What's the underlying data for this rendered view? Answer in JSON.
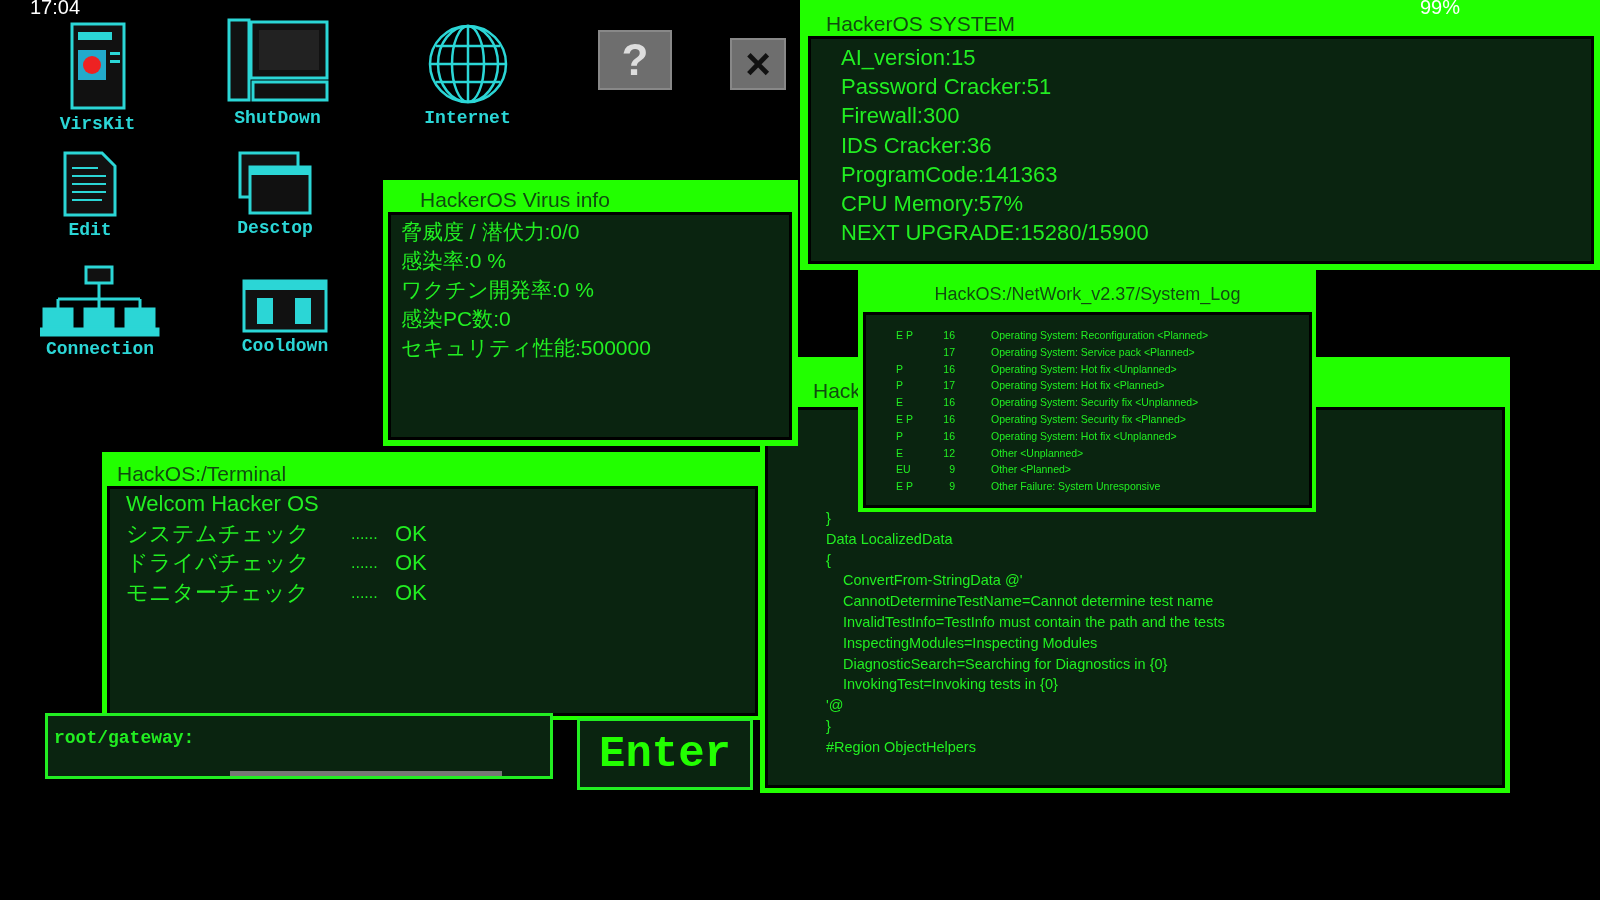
{
  "status_bar": {
    "time": "17:04",
    "battery": "99%"
  },
  "desktop_icons": [
    {
      "kind": "virus",
      "label": "VirsKit"
    },
    {
      "kind": "computer",
      "label": "ShutDown"
    },
    {
      "kind": "globe",
      "label": "Internet"
    },
    {
      "kind": "document",
      "label": "Edit"
    },
    {
      "kind": "windows",
      "label": "Desctop"
    },
    {
      "kind": "network",
      "label": "Connection"
    },
    {
      "kind": "panel",
      "label": "Cooldown"
    }
  ],
  "top_buttons": [
    {
      "kind": "help",
      "symbol": "?"
    },
    {
      "kind": "close",
      "symbol": "×"
    }
  ],
  "windows": [
    {
      "kind": "system",
      "title": "HackerOS SYSTEM",
      "lines": [
        "AI_version:15",
        "Password  Cracker:51",
        "Firewall:300",
        "IDS  Cracker:36",
        "ProgramCode:141363",
        "CPU  Memory:57%",
        "NEXT  UPGRADE:15280/15900"
      ]
    },
    {
      "kind": "virus",
      "title": "HackerOS Virus  info",
      "lines": [
        "脅威度 / 潜伏力:0/0",
        "感染率:0 %",
        "ワクチン開発率:0 %",
        "感染PC数:0",
        "セキュリティ性能:500000"
      ]
    },
    {
      "kind": "log",
      "title": "HackOS:/NetWork_v2.37/System_Log",
      "rows": [
        {
          "flags": "E P",
          "number": "16",
          "message": "Operating System: Reconfiguration <Planned>"
        },
        {
          "flags": "",
          "number": "17",
          "message": "Operating System: Service pack <Planned>"
        },
        {
          "flags": "P",
          "number": "16",
          "message": "Operating System: Hot fix <Unplanned>"
        },
        {
          "flags": "P",
          "number": "17",
          "message": "Operating System: Hot fix <Planned>"
        },
        {
          "flags": "E",
          "number": "16",
          "message": "Operating System: Security fix <Unplanned>"
        },
        {
          "flags": "E P",
          "number": "16",
          "message": "Operating System: Security fix <Planned>"
        },
        {
          "flags": "P",
          "number": "16",
          "message": "Operating System: Hot fix <Unplanned>"
        },
        {
          "flags": "E",
          "number": "12",
          "message": "Other <Unplanned>"
        },
        {
          "flags": "EU",
          "number": "9",
          "message": "Other <Planned>"
        },
        {
          "flags": "E P",
          "number": "9",
          "message": "Other Failure: System Unresponsive"
        }
      ]
    },
    {
      "kind": "code",
      "title": "Hack",
      "lines": [
        {
          "text": "}",
          "indent": false
        },
        {
          "text": "Data LocalizedData",
          "indent": false
        },
        {
          "text": "{",
          "indent": false
        },
        {
          "text": "ConvertFrom-StringData @'",
          "indent": true
        },
        {
          "text": "CannotDetermineTestName=Cannot determine test name",
          "indent": true
        },
        {
          "text": "InvalidTestInfo=TestInfo must contain the path and the tests",
          "indent": true
        },
        {
          "text": "InspectingModules=Inspecting Modules",
          "indent": true
        },
        {
          "text": "DiagnosticSearch=Searching for Diagnostics in {0}",
          "indent": true
        },
        {
          "text": "InvokingTest=Invoking tests in {0}",
          "indent": true
        },
        {
          "text": "'@",
          "indent": false
        },
        {
          "text": "}",
          "indent": false
        },
        {
          "text": "#Region ObjectHelpers",
          "indent": false
        }
      ]
    },
    {
      "kind": "terminal",
      "title": "HackOS:/Terminal",
      "lines": [
        {
          "label": "Welcom  Hacker OS"
        },
        {
          "label": "システムチェック",
          "dots": "......",
          "result": "OK"
        },
        {
          "label": "ドライバチェック",
          "dots": "......",
          "result": "OK"
        },
        {
          "label": "モニターチェック",
          "dots": "......",
          "result": "OK"
        }
      ]
    }
  ],
  "command": {
    "value": "root/gateway:",
    "button": "Enter"
  }
}
